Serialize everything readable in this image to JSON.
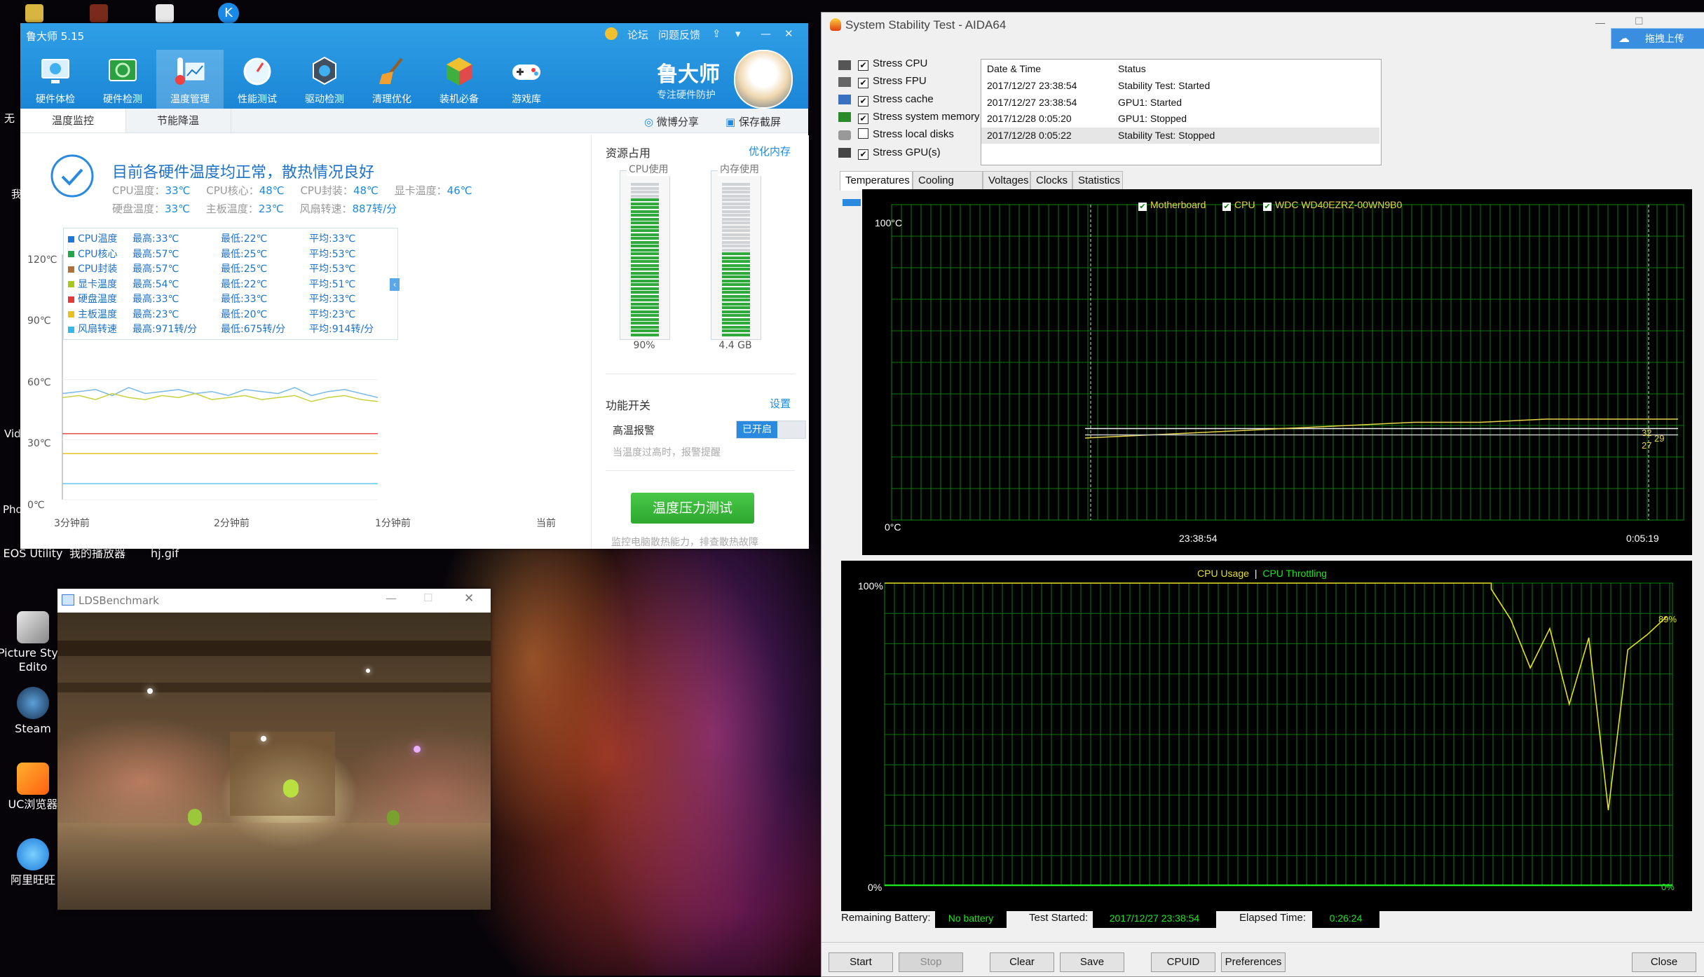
{
  "desktop": {
    "icons": [
      {
        "label": "EOS Utility"
      },
      {
        "label": "我的播放器"
      },
      {
        "label": "hj.gif"
      },
      {
        "label": "Picture Style Edito"
      },
      {
        "label": "Steam"
      },
      {
        "label": "UC浏览器"
      },
      {
        "label": "阿里旺旺"
      }
    ],
    "side_texts": [
      "无",
      "我",
      "Vid",
      "Pho"
    ]
  },
  "ludashi": {
    "title": "鲁大师 5.15",
    "top_links": [
      "论坛",
      "问题反馈"
    ],
    "nav": [
      {
        "label": "硬件体检",
        "icon": "monitor-icon"
      },
      {
        "label": "硬件检测",
        "icon": "chip-icon"
      },
      {
        "label": "温度管理",
        "icon": "thermometer-icon"
      },
      {
        "label": "性能测试",
        "icon": "gauge-icon"
      },
      {
        "label": "驱动检测",
        "icon": "gear-icon"
      },
      {
        "label": "清理优化",
        "icon": "broom-icon"
      },
      {
        "label": "装机必备",
        "icon": "box-icon"
      },
      {
        "label": "游戏库",
        "icon": "gamepad-icon"
      }
    ],
    "brand": {
      "name": "鲁大师",
      "slogan": "专注硬件防护"
    },
    "tabs": [
      "温度监控",
      "节能降温"
    ],
    "share_label": "微博分享",
    "screenshot_label": "保存截屏",
    "headline": "目前各硬件温度均正常，散热情况良好",
    "stats_row1": [
      {
        "label": "CPU温度：",
        "value": "33℃"
      },
      {
        "label": "CPU核心：",
        "value": "48℃"
      },
      {
        "label": "CPU封装：",
        "value": "48℃"
      },
      {
        "label": "显卡温度：",
        "value": "46℃"
      }
    ],
    "stats_row2": [
      {
        "label": "硬盘温度：",
        "value": "33℃"
      },
      {
        "label": "主板温度：",
        "value": "23℃"
      },
      {
        "label": "风扇转速：",
        "value": "887转/分"
      }
    ],
    "legend": [
      {
        "name": "CPU温度",
        "max": "最高:33℃",
        "min": "最低:22℃",
        "avg": "平均:33℃",
        "color": "#1e78d8"
      },
      {
        "name": "CPU核心",
        "max": "最高:57℃",
        "min": "最低:25℃",
        "avg": "平均:53℃",
        "color": "#22a84a"
      },
      {
        "name": "CPU封装",
        "max": "最高:57℃",
        "min": "最低:25℃",
        "avg": "平均:53℃",
        "color": "#b0703a"
      },
      {
        "name": "显卡温度",
        "max": "最高:54℃",
        "min": "最低:22℃",
        "avg": "平均:51℃",
        "color": "#a8c81e"
      },
      {
        "name": "硬盘温度",
        "max": "最高:33℃",
        "min": "最低:33℃",
        "avg": "平均:33℃",
        "color": "#e03a3a"
      },
      {
        "name": "主板温度",
        "max": "最高:23℃",
        "min": "最低:20℃",
        "avg": "平均:23℃",
        "color": "#e8c020"
      },
      {
        "name": "风扇转速",
        "max": "最高:971转/分",
        "min": "最低:675转/分",
        "avg": "平均:914转/分",
        "color": "#38b8e8"
      }
    ],
    "y_ticks": [
      "120℃",
      "90℃",
      "60℃",
      "30℃",
      "0℃"
    ],
    "x_ticks": [
      "3分钟前",
      "2分钟前",
      "1分钟前",
      "当前"
    ],
    "resources": {
      "title": "资源占用",
      "optimize": "优化内存",
      "cpu_label": "CPU使用",
      "cpu_value": "90%",
      "cpu_fraction": 0.9,
      "mem_label": "内存使用",
      "mem_value": "4.4 GB",
      "mem_fraction": 0.55
    },
    "functions": {
      "title": "功能开关",
      "settings": "设置",
      "alarm_label": "高温报警",
      "alarm_state": "已开启",
      "alarm_desc": "当温度过高时，报警提醒"
    },
    "stress_button": "温度压力测试",
    "stress_desc": "监控电脑散热能力，排查散热故障",
    "colors": {
      "header": "#1b86d6",
      "green_button": "#3cb83c"
    }
  },
  "benchmark": {
    "title": "LDSBenchmark"
  },
  "aida": {
    "title": "System Stability Test - AIDA64",
    "upload_label": "拖拽上传",
    "checks": [
      {
        "label": "Stress CPU",
        "checked": true
      },
      {
        "label": "Stress FPU",
        "checked": true
      },
      {
        "label": "Stress cache",
        "checked": true
      },
      {
        "label": "Stress system memory",
        "checked": true
      },
      {
        "label": "Stress local disks",
        "checked": false
      },
      {
        "label": "Stress GPU(s)",
        "checked": true
      }
    ],
    "log_headers": {
      "date": "Date & Time",
      "status": "Status"
    },
    "log": [
      {
        "date": "2017/12/27 23:38:54",
        "status": "Stability Test: Started"
      },
      {
        "date": "2017/12/27 23:38:54",
        "status": "GPU1: Started"
      },
      {
        "date": "2017/12/28 0:05:20",
        "status": "GPU1: Stopped"
      },
      {
        "date": "2017/12/28 0:05:22",
        "status": "Stability Test: Stopped"
      }
    ],
    "tabs": [
      "Temperatures",
      "Cooling Fans",
      "Voltages",
      "Clocks",
      "Statistics"
    ],
    "temp_graph": {
      "legend": [
        "Motherboard",
        "CPU",
        "WDC WD40EZRZ-00WN9B0"
      ],
      "y_top": "100°C",
      "y_bottom": "0°C",
      "x_start": "23:38:54",
      "x_end": "0:05:19",
      "end_values": [
        "32",
        "29",
        "27"
      ]
    },
    "usage_graph": {
      "legend_usage": "CPU Usage",
      "legend_sep": "|",
      "legend_throttle": "CPU Throttling",
      "y_top": "100%",
      "y_bottom": "0%",
      "right_top": "89%",
      "right_bottom": "0%"
    },
    "status": {
      "battery_label": "Remaining Battery:",
      "battery_value": "No battery",
      "started_label": "Test Started:",
      "started_value": "2017/12/27 23:38:54",
      "elapsed_label": "Elapsed Time:",
      "elapsed_value": "0:26:24"
    },
    "buttons": {
      "start": "Start",
      "stop": "Stop",
      "clear": "Clear",
      "save": "Save",
      "cpuid": "CPUID",
      "preferences": "Preferences",
      "close": "Close"
    }
  },
  "chart_data": [
    {
      "type": "line",
      "title": "",
      "x": [
        "3分钟前",
        "2分钟前",
        "1分钟前",
        "当前"
      ],
      "ylim": [
        0,
        120
      ],
      "series": [
        {
          "name": "CPU核心",
          "values": [
            53,
            54,
            55,
            52,
            56,
            53,
            54,
            55,
            53,
            54,
            52,
            55,
            54,
            53,
            56,
            52,
            54,
            55,
            53,
            51
          ]
        },
        {
          "name": "显卡温度",
          "values": [
            51,
            52,
            50,
            53,
            51,
            50,
            52,
            51,
            53,
            50,
            51,
            52,
            50,
            51,
            52,
            49,
            51,
            52,
            50,
            49
          ]
        },
        {
          "name": "硬盘温度",
          "values": [
            33,
            33,
            33,
            33,
            33,
            33,
            33,
            33,
            33,
            33,
            33,
            33,
            33,
            33,
            33,
            33,
            33,
            33,
            33,
            33
          ]
        },
        {
          "name": "主板温度",
          "values": [
            23,
            23,
            23,
            23,
            23,
            23,
            23,
            23,
            23,
            23,
            23,
            23,
            23,
            23,
            23,
            23,
            23,
            23,
            23,
            23
          ]
        },
        {
          "name": "风扇转速",
          "values": [
            8,
            8,
            8,
            8,
            8,
            8,
            8,
            8,
            8,
            8,
            8,
            8,
            8,
            8,
            8,
            8,
            8,
            8,
            8,
            8
          ]
        }
      ]
    },
    {
      "type": "line",
      "title": "",
      "x_labels": [
        "23:38:54",
        "0:05:19"
      ],
      "ylim": [
        0,
        100
      ],
      "series": [
        {
          "name": "Motherboard",
          "values": [
            29,
            29,
            29,
            29,
            29,
            29,
            29,
            29,
            29,
            29
          ]
        },
        {
          "name": "CPU",
          "values": [
            26,
            27,
            28,
            29,
            30,
            31,
            31,
            32,
            32,
            32
          ]
        },
        {
          "name": "WDC WD40EZRZ-00WN9B0",
          "values": [
            27,
            27,
            27,
            27,
            27,
            27,
            27,
            27,
            27,
            27
          ]
        }
      ]
    },
    {
      "type": "line",
      "title": "",
      "ylim": [
        0,
        100
      ],
      "series": [
        {
          "name": "CPU Usage",
          "values": [
            100,
            100,
            100,
            100,
            100,
            100,
            100,
            100,
            100,
            100,
            100,
            100,
            100,
            100,
            98,
            88,
            72,
            85,
            60,
            82,
            25,
            78,
            83,
            89
          ]
        },
        {
          "name": "CPU Throttling",
          "values": [
            0,
            0,
            0,
            0,
            0,
            0,
            0,
            0,
            0,
            0,
            0,
            0,
            0,
            0,
            0,
            0,
            0,
            0,
            0,
            0,
            0,
            0,
            0,
            0
          ]
        }
      ]
    }
  ]
}
